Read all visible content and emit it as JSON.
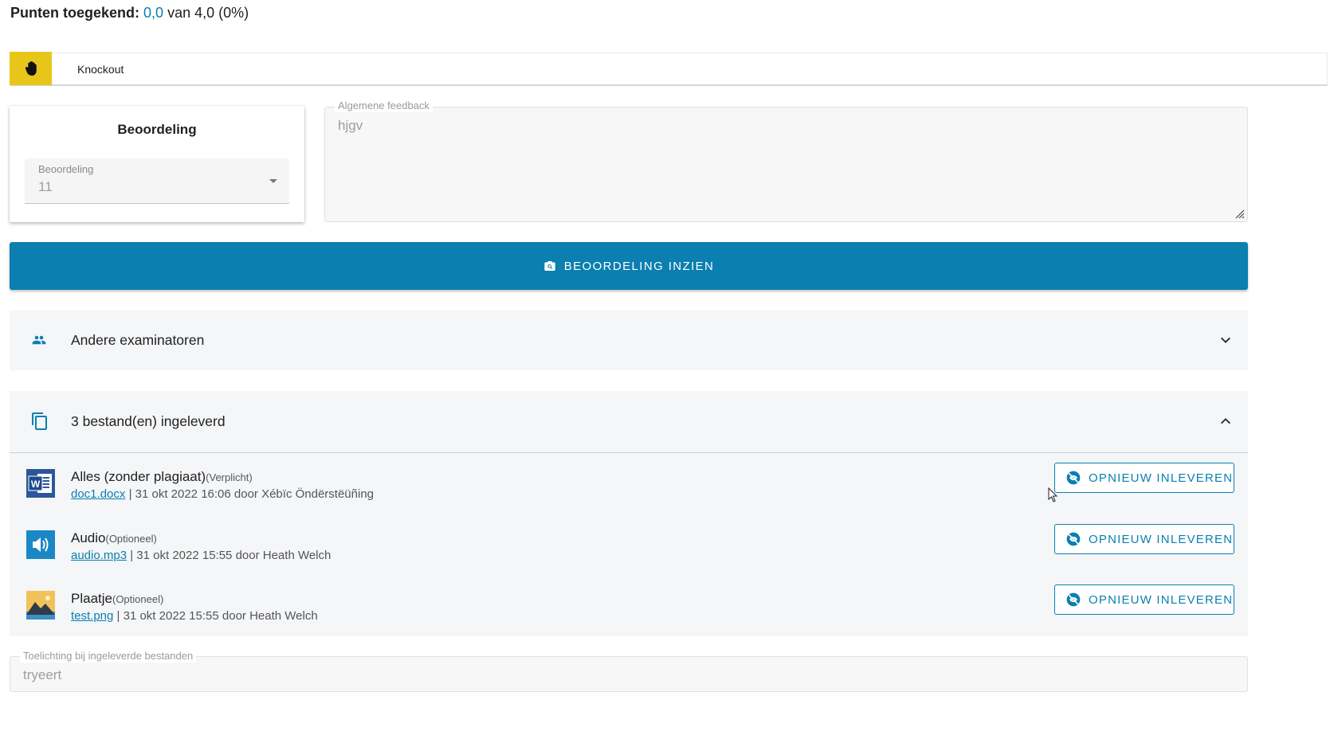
{
  "points": {
    "label": "Punten toegekend:",
    "value": "0,0",
    "rest": "van 4,0 (0%)"
  },
  "knockout": {
    "icon": "hand-icon",
    "label": "Knockout"
  },
  "beoordeling": {
    "title": "Beoordeling",
    "field_label": "Beoordeling",
    "selected_value": "11"
  },
  "feedback": {
    "label": "Algemene feedback",
    "value": "hjgv"
  },
  "view_button": {
    "icon": "search-photo-icon",
    "label": "BEOORDELING INZIEN"
  },
  "examiners": {
    "icon": "people-icon",
    "label": "Andere examinatoren",
    "expanded": false
  },
  "files": {
    "icon": "copy-icon",
    "label": "3 bestand(en) ingeleverd",
    "expanded": true,
    "items": [
      {
        "icon": "word-file-icon",
        "name": "Alles (zonder plagiaat)",
        "requirement": "(Verplicht)",
        "file": "doc1.docx",
        "meta": "| 31 okt 2022 16:06 door Xébïc Öndërstëüñing",
        "button": "OPNIEUW INLEVEREN"
      },
      {
        "icon": "audio-file-icon",
        "name": "Audio",
        "requirement": "(Optioneel)",
        "file": "audio.mp3",
        "meta": "| 31 okt 2022 15:55 door Heath Welch",
        "button": "OPNIEUW INLEVEREN"
      },
      {
        "icon": "image-file-icon",
        "name": "Plaatje",
        "requirement": "(Optioneel)",
        "file": "test.png",
        "meta": "| 31 okt 2022 15:55 door Heath Welch",
        "button": "OPNIEUW INLEVEREN"
      }
    ]
  },
  "explanation": {
    "label": "Toelichting bij ingeleverde bestanden",
    "value": "tryeert"
  },
  "colors": {
    "accent": "#0a7fb0",
    "knockout": "#e8c619",
    "panel_bg": "#f5f6f8"
  }
}
